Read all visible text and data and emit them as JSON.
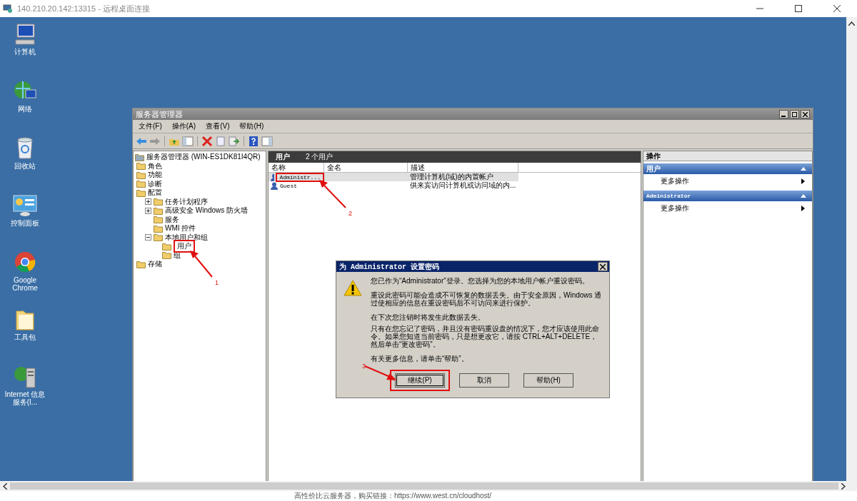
{
  "rdp_window": {
    "title": "140.210.20.142:13315 - 远程桌面连接"
  },
  "desktop_icons": [
    {
      "label": "计算机",
      "kind": "computer"
    },
    {
      "label": "网络",
      "kind": "network"
    },
    {
      "label": "回收站",
      "kind": "trash"
    },
    {
      "label": "控制面板",
      "kind": "panel"
    },
    {
      "label": "Google Chrome",
      "kind": "browser"
    },
    {
      "label": "工具包",
      "kind": "folder"
    },
    {
      "label": "Internet 信息服务(I...",
      "kind": "server"
    }
  ],
  "server_manager": {
    "title": "服务器管理器",
    "menu": [
      "文件(F)",
      "操作(A)",
      "查看(V)",
      "帮助(H)"
    ],
    "tree": [
      {
        "label": "服务器管理器 (WIN-ES1DK81I4QR)",
        "children": [
          {
            "label": "角色"
          },
          {
            "label": "功能"
          },
          {
            "label": "诊断"
          },
          {
            "label": "配置",
            "children": [
              {
                "label": "任务计划程序",
                "expanded": false
              },
              {
                "label": "高级安全 Windows 防火墙",
                "expanded": false
              },
              {
                "label": "服务"
              },
              {
                "label": "WMI 控件"
              },
              {
                "label": "本地用户和组",
                "expanded": true,
                "children": [
                  {
                    "label": "用户",
                    "marked": true
                  },
                  {
                    "label": "组",
                    "marked": false
                  }
                ]
              }
            ]
          },
          {
            "label": "存储"
          }
        ]
      }
    ],
    "content": {
      "heading": "用户",
      "count": "2 个用户",
      "columns": [
        "名称",
        "全名",
        "描述"
      ],
      "rows": [
        {
          "name": "Administr...",
          "description": "管理计算机(域)的内置帐户",
          "selected": true,
          "marked": true
        },
        {
          "name": "Guest",
          "description": "供来宾访问计算机或访问域的内...",
          "selected": false,
          "marked": false
        }
      ]
    },
    "actions": {
      "title": "操作",
      "sections": [
        {
          "title": "用户",
          "items": [
            "更多操作"
          ]
        },
        {
          "title": "Administrator",
          "items": [
            "更多操作"
          ]
        }
      ]
    }
  },
  "dialog": {
    "title": "为 Administrator 设置密码",
    "paragraphs": [
      "您已作为“Administrator”登录。您选择为您的本地用户帐户重设密码。",
      "重设此密码可能会造成不可恢复的数据丢失。由于安全原因，Windows 通过使相应的信息在重设密码后不可访问来进行保护。",
      "在下次您注销时将发生此数据丢失。",
      "只有在您忘记了密码，并且没有密码重设盘的情况下，您才应该使用此命令。如果您知道当前密码，只是想更改它，请按 CTRL+ALT+DELETE，然后单击“更改密码”。",
      "有关更多信息，请单击“帮助”。"
    ],
    "buttons": [
      {
        "label": "继续(P)",
        "default": true,
        "marked": true
      },
      {
        "label": "取消",
        "default": false,
        "marked": false
      },
      {
        "label": "帮助(H)",
        "default": false,
        "marked": false
      }
    ]
  },
  "annotations": [
    {
      "label": "1"
    },
    {
      "label": "2"
    },
    {
      "label": "3"
    }
  ],
  "footer_text": "高性价比云服务器，购买链接：https://www.west.cn/cloudhost/"
}
